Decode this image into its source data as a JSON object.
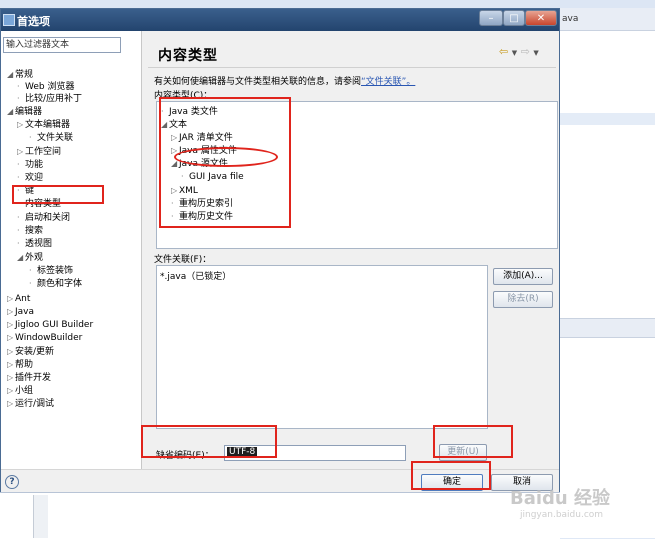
{
  "dialog": {
    "title": "首选项"
  },
  "filter": {
    "placeholder": "输入过滤器文本"
  },
  "left_tree": [
    {
      "label": "常规",
      "prefix": "◢"
    },
    {
      "label": "Web 浏览器",
      "prefix": "·"
    },
    {
      "label": "比较/应用补丁",
      "prefix": "·"
    },
    {
      "label": "编辑器",
      "prefix": "◢"
    },
    {
      "label": "文本编辑器",
      "prefix": "▷"
    },
    {
      "label": "文件关联",
      "prefix": "·"
    },
    {
      "label": "工作空间",
      "prefix": "▷"
    },
    {
      "label": "功能",
      "prefix": "·"
    },
    {
      "label": "欢迎",
      "prefix": "·"
    },
    {
      "label": "键",
      "prefix": "·"
    },
    {
      "label": "内容类型",
      "prefix": "·"
    },
    {
      "label": "启动和关闭",
      "prefix": "·"
    },
    {
      "label": "搜索",
      "prefix": "·"
    },
    {
      "label": "透视图",
      "prefix": "·"
    },
    {
      "label": "外观",
      "prefix": "◢"
    },
    {
      "label": "标签装饰",
      "prefix": "·"
    },
    {
      "label": "颜色和字体",
      "prefix": "·"
    },
    {
      "label": "Ant",
      "prefix": "▷"
    },
    {
      "label": "Java",
      "prefix": "▷"
    },
    {
      "label": "Jigloo GUI Builder",
      "prefix": "▷"
    },
    {
      "label": "WindowBuilder",
      "prefix": "▷"
    },
    {
      "label": "安装/更新",
      "prefix": "▷"
    },
    {
      "label": "帮助",
      "prefix": "▷"
    },
    {
      "label": "插件开发",
      "prefix": "▷"
    },
    {
      "label": "小组",
      "prefix": "▷"
    },
    {
      "label": "运行/调试",
      "prefix": "▷"
    }
  ],
  "page": {
    "title": "内容类型",
    "description": "有关如何使编辑器与文件类型相关联的信息，请参阅",
    "description_link": "“文件关联”。",
    "content_types_label": "内容类型(C)："
  },
  "content_tree": [
    {
      "label": "Java 类文件",
      "prefix": "·"
    },
    {
      "label": "文本",
      "prefix": "◢"
    },
    {
      "label": "JAR 清单文件",
      "prefix": "▷"
    },
    {
      "label": "Java 属性文件",
      "prefix": "▷"
    },
    {
      "label": "Java 源文件",
      "prefix": "◢"
    },
    {
      "label": "GUI Java file",
      "prefix": "·"
    },
    {
      "label": "XML",
      "prefix": "▷"
    },
    {
      "label": "重构历史索引",
      "prefix": "·"
    },
    {
      "label": "重构历史文件",
      "prefix": "·"
    }
  ],
  "file_assoc": {
    "label": "文件关联(F)：",
    "items": [
      "*.java（已锁定）"
    ],
    "add_label": "添加(A)...",
    "remove_label": "除去(R)"
  },
  "encoding": {
    "label": "缺省编码(E)：",
    "value": "UTF-8",
    "update_label": "更新(U)"
  },
  "footer": {
    "help": "?",
    "ok_label": "确定",
    "cancel_label": "取消"
  },
  "background": {
    "right_header_text": "ava"
  },
  "watermark": {
    "brand": "Baidu 经验",
    "url": "jingyan.baidu.com"
  },
  "colors": {
    "highlight": "#e0241c",
    "titlebar": "#2d5282",
    "link": "#2956b2"
  }
}
